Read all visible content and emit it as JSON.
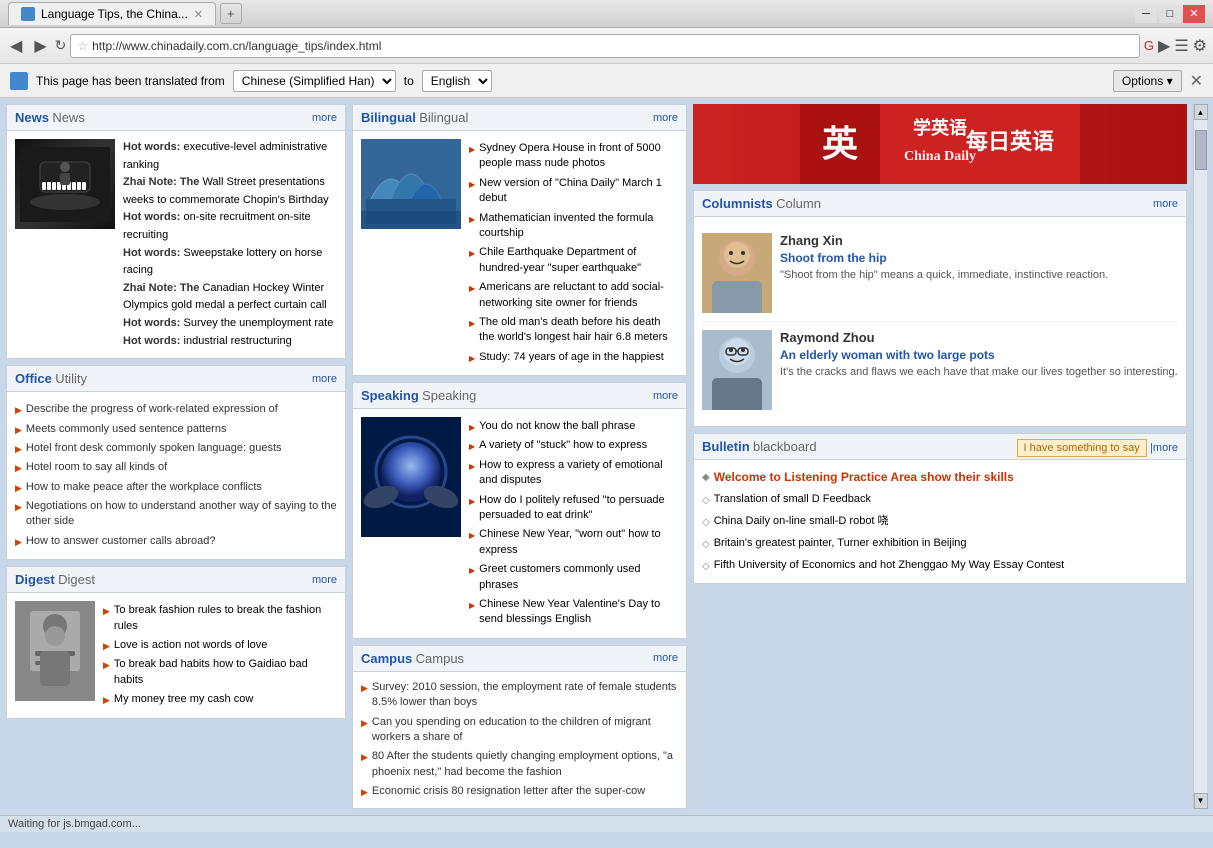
{
  "browser": {
    "tab_title": "Language Tips, the China...",
    "tab_new_label": "+",
    "url": "http://www.chinadaily.com.cn/language_tips/index.html",
    "win_min": "─",
    "win_max": "□",
    "win_close": "✕"
  },
  "translation_bar": {
    "text": "This page has been translated from",
    "from_lang": "Chinese (Simplified Han)",
    "to_label": "to",
    "to_lang": "English",
    "options_label": "Options ▾"
  },
  "news": {
    "section_title": "News",
    "section_sub": "News",
    "more": "more",
    "items": [
      "Hot words: executive-level administrative ranking",
      "Zhai Note: The Wall Street presentations weeks to commemorate Chopin's Birthday",
      "Hot words: on-site recruitment on-site recruiting",
      "Hot words: Sweepstake lottery on horse racing",
      "Zhai Note: The Canadian Hockey Winter Olympics gold medal a perfect curtain call",
      "Hot words: Survey the unemployment rate",
      "Hot words: industrial restructuring"
    ]
  },
  "bilingual": {
    "section_title": "Bilingual",
    "section_sub": "Bilingual",
    "more": "more",
    "items": [
      "Sydney Opera House in front of 5000 people mass nude photos",
      "New version of \"China Daily\" March 1 debut",
      "Mathematician invented the formula courtship",
      "Chile Earthquake Department of hundred-year \"super earthquake\"",
      "Americans are reluctant to add social-networking site owner for friends",
      "The old man's death before his death the world's longest hair hair 6.8 meters",
      "Study: 74 years of age in the happiest"
    ]
  },
  "office": {
    "section_title": "Office",
    "section_sub": "Utility",
    "more": "more",
    "items": [
      "Describe the progress of work-related expression of",
      "Meets commonly used sentence patterns",
      "Hotel front desk commonly spoken language: guests",
      "Hotel room to say all kinds of",
      "How to make peace after the workplace conflicts",
      "Negotiations on how to understand another way of saying to the other side",
      "How to answer customer calls abroad?"
    ]
  },
  "speaking": {
    "section_title": "Speaking",
    "section_sub": "Speaking",
    "more": "more",
    "items": [
      "You do not know the ball phrase",
      "A variety of \"stuck\" how to express",
      "How to express a variety of emotional and disputes",
      "How do I politely refused \"to persuade persuaded to eat drink\"",
      "Chinese New Year, \"worn out\" how to express",
      "Greet customers commonly used phrases",
      "Chinese New Year Valentine's Day to send blessings English"
    ]
  },
  "columnists": {
    "section_title": "Columnists",
    "section_sub": "Column",
    "more": "more",
    "people": [
      {
        "name": "Zhang Xin",
        "article_title": "Shoot from the hip",
        "desc": "\"Shoot from the hip\" means a quick, immediate, instinctive reaction."
      },
      {
        "name": "Raymond Zhou",
        "article_title": "An elderly woman with two large pots",
        "desc": "It's the cracks and flaws we each have that make our lives together so interesting."
      }
    ]
  },
  "bulletin": {
    "section_title": "Bulletin",
    "section_sub": "blackboard",
    "tag": "I have something to say",
    "more": "|more",
    "items": [
      {
        "text": "Welcome to Listening Practice Area show their skills",
        "highlight": true
      },
      {
        "text": "Translation of small D Feedback",
        "highlight": false
      },
      {
        "text": "China Daily on-line small-D robot 哓",
        "highlight": false
      },
      {
        "text": "Britain's greatest painter, Turner exhibition in Beijing",
        "highlight": false
      },
      {
        "text": "Fifth University of Economics and hot Zhenggao My Way Essay Contest",
        "highlight": false
      }
    ]
  },
  "digest": {
    "section_title": "Digest",
    "section_sub": "Digest",
    "more": "more",
    "items": [
      "To break fashion rules to break the fashion rules",
      "Love is action not words of love",
      "To break bad habits how to Gaidiao bad habits",
      "My money tree my cash cow"
    ]
  },
  "campus": {
    "section_title": "Campus",
    "section_sub": "Campus",
    "more": "more",
    "items": [
      "Survey: 2010 session, the employment rate of female students 8.5% lower than boys",
      "Can you spending on education to the children of migrant workers a share of",
      "80 After the students quietly changing employment options, \"a phoenix nest,\" had become the fashion",
      "Economic crisis 80 resignation letter after the super-cow"
    ]
  },
  "status_bar": {
    "text": "Waiting for js.bmgad.com..."
  }
}
